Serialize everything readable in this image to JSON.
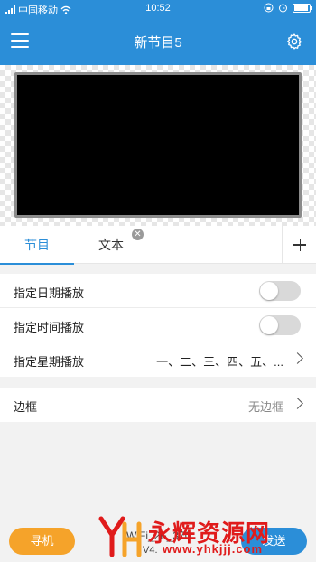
{
  "status_bar": {
    "carrier": "中国移动",
    "time": "10:52"
  },
  "header": {
    "title": "新节目5",
    "menu_icon": "hamburger-menu-icon",
    "settings_icon": "gear-icon"
  },
  "tabs": {
    "items": [
      {
        "label": "节目",
        "active": true
      },
      {
        "label": "文本",
        "active": false
      }
    ],
    "add_icon": "plus-icon",
    "close_icon": "close-icon"
  },
  "settings": {
    "date_play": {
      "label": "指定日期播放",
      "enabled": false
    },
    "time_play": {
      "label": "指定时间播放",
      "enabled": false
    },
    "weekday_play": {
      "label": "指定星期播放",
      "value": "一、二、三、四、五、..."
    }
  },
  "border": {
    "label": "边框",
    "value": "无边框"
  },
  "bottom_bar": {
    "find_button": "寻机",
    "wifi_name": "WiFi_2F_370",
    "version": "V4.",
    "send_button": "发送"
  },
  "watermark": {
    "name": "永辉资源网",
    "url": "www.yhkjjj.com"
  },
  "colors": {
    "accent": "#2b8ed8",
    "find_button": "#f5a32a",
    "watermark": "#e01b1b"
  }
}
